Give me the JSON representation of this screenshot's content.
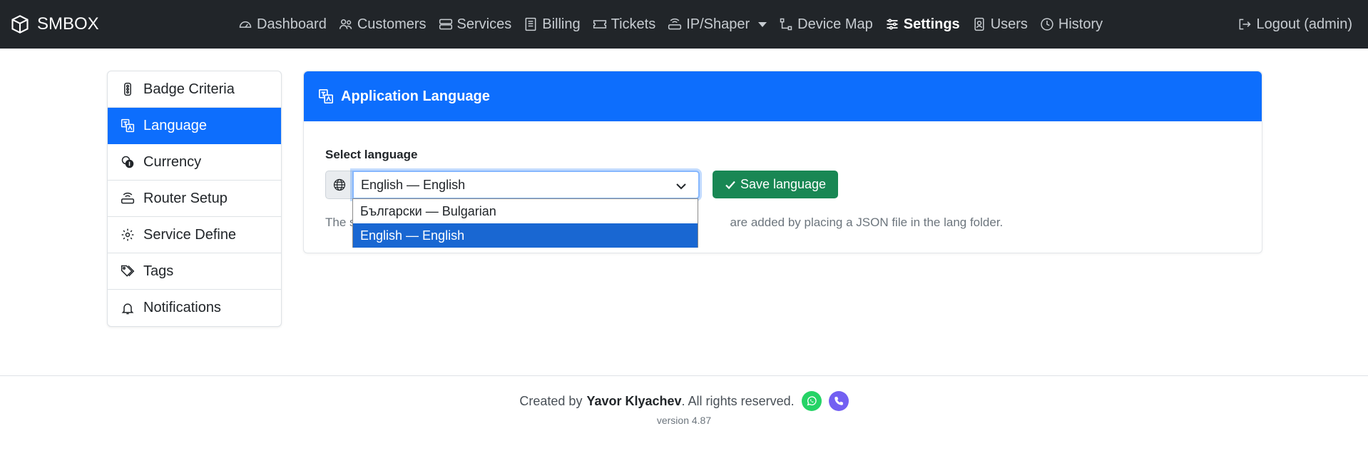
{
  "colors": {
    "navbar_bg": "#212529",
    "primary": "#0d6efd",
    "success": "#198754",
    "dropdown_selected": "#1967d2",
    "whatsapp": "#25d366",
    "viber": "#7360f2"
  },
  "navbar": {
    "brand": "SMBOX",
    "brand_icon": "box-icon",
    "items": [
      {
        "label": "Dashboard",
        "icon": "speedometer-icon"
      },
      {
        "label": "Customers",
        "icon": "people-icon"
      },
      {
        "label": "Services",
        "icon": "hdd-stack-icon"
      },
      {
        "label": "Billing",
        "icon": "receipt-icon"
      },
      {
        "label": "Tickets",
        "icon": "ticket-icon"
      },
      {
        "label": "IP/Shaper",
        "icon": "router-icon",
        "dropdown": true
      },
      {
        "label": "Device Map",
        "icon": "diagram-icon"
      },
      {
        "label": "Settings",
        "icon": "sliders-icon",
        "active": true
      },
      {
        "label": "Users",
        "icon": "person-badge-icon"
      },
      {
        "label": "History",
        "icon": "clock-icon"
      }
    ],
    "logout": "Logout (admin)"
  },
  "sidebar": {
    "items": [
      {
        "label": "Badge Criteria",
        "icon": "traffic-light-icon"
      },
      {
        "label": "Language",
        "icon": "translate-icon",
        "active": true
      },
      {
        "label": "Currency",
        "icon": "coins-icon"
      },
      {
        "label": "Router Setup",
        "icon": "router-icon"
      },
      {
        "label": "Service Define",
        "icon": "gear-icon"
      },
      {
        "label": "Tags",
        "icon": "tags-icon"
      },
      {
        "label": "Notifications",
        "icon": "bell-icon"
      }
    ]
  },
  "card": {
    "title": "Application Language",
    "label": "Select language",
    "selected_value": "English — English",
    "options": [
      "Български — Bulgarian",
      "English — English"
    ],
    "selected_index": 1,
    "save_label": "Save language",
    "help_prefix": "The s",
    "help_suffix": "are added by placing a JSON file in the lang folder."
  },
  "footer": {
    "prefix": "Created by",
    "author": "Yavor Klyachev",
    "suffix": ". All rights reserved.",
    "version": "version 4.87"
  }
}
